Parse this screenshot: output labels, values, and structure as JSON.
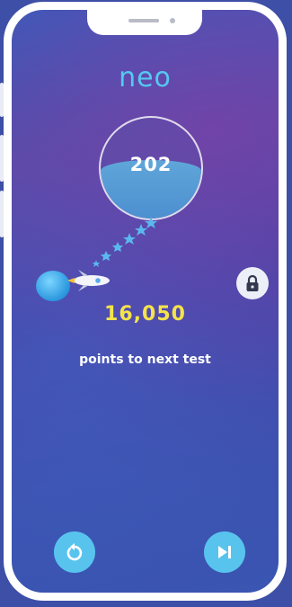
{
  "app": {
    "logo_text": "neo"
  },
  "progress": {
    "level_number": "202"
  },
  "points": {
    "value": "16,050",
    "caption": "points to next test"
  },
  "controls": {
    "replay_icon": "replay-icon",
    "skip_icon": "skip-next-icon",
    "lock_icon": "lock-icon"
  },
  "colors": {
    "accent": "#58c4ee",
    "points": "#f5e34a"
  }
}
